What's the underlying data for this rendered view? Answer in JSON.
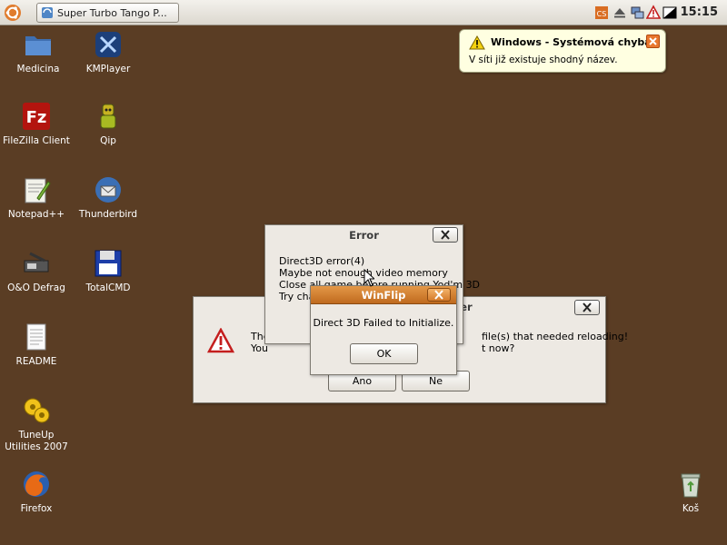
{
  "taskbar": {
    "task_button_label": "Super Turbo Tango P...",
    "clock": "15:15"
  },
  "desktop_icons": [
    {
      "label": "Medicina",
      "icon": "folder-icon"
    },
    {
      "label": "KMPlayer",
      "icon": "kmplayer-icon"
    },
    {
      "label": "FileZilla Client",
      "icon": "filezilla-icon"
    },
    {
      "label": "Qip",
      "icon": "qip-icon"
    },
    {
      "label": "Notepad++",
      "icon": "notepad-icon"
    },
    {
      "label": "Thunderbird",
      "icon": "thunderbird-icon"
    },
    {
      "label": "O&O Defrag",
      "icon": "defrag-icon"
    },
    {
      "label": "TotalCMD",
      "icon": "totalcmd-icon"
    },
    {
      "label": "README",
      "icon": "text-document-icon"
    },
    {
      "label": "TuneUp Utilities 2007",
      "icon": "tuneup-icon"
    },
    {
      "label": "Firefox",
      "icon": "firefox-icon"
    },
    {
      "label": "Koš",
      "icon": "trash-icon"
    }
  ],
  "balloon": {
    "title": "Windows - Systémová chyba",
    "message": "V síti již existuje shodný název."
  },
  "back_dialog": {
    "title_partial": "der",
    "line1_start": "The",
    "line1_end": "file(s) that needed reloading!",
    "line2_start": "You",
    "line2_end": "t now?",
    "yes_label": "Ano",
    "no_label": "Ne"
  },
  "error_dialog": {
    "title": "Error",
    "lines": [
      "Direct3D error(4)",
      "Maybe not enough video memory",
      "Close all game before running Yod'm 3D",
      "Try cha"
    ]
  },
  "winflip_dialog": {
    "title": "WinFlip",
    "message": "Direct 3D Failed to Initialize.",
    "ok_label": "OK"
  },
  "colors": {
    "desktop": "#5a3d24",
    "winflip_title": "#d07f2f"
  }
}
